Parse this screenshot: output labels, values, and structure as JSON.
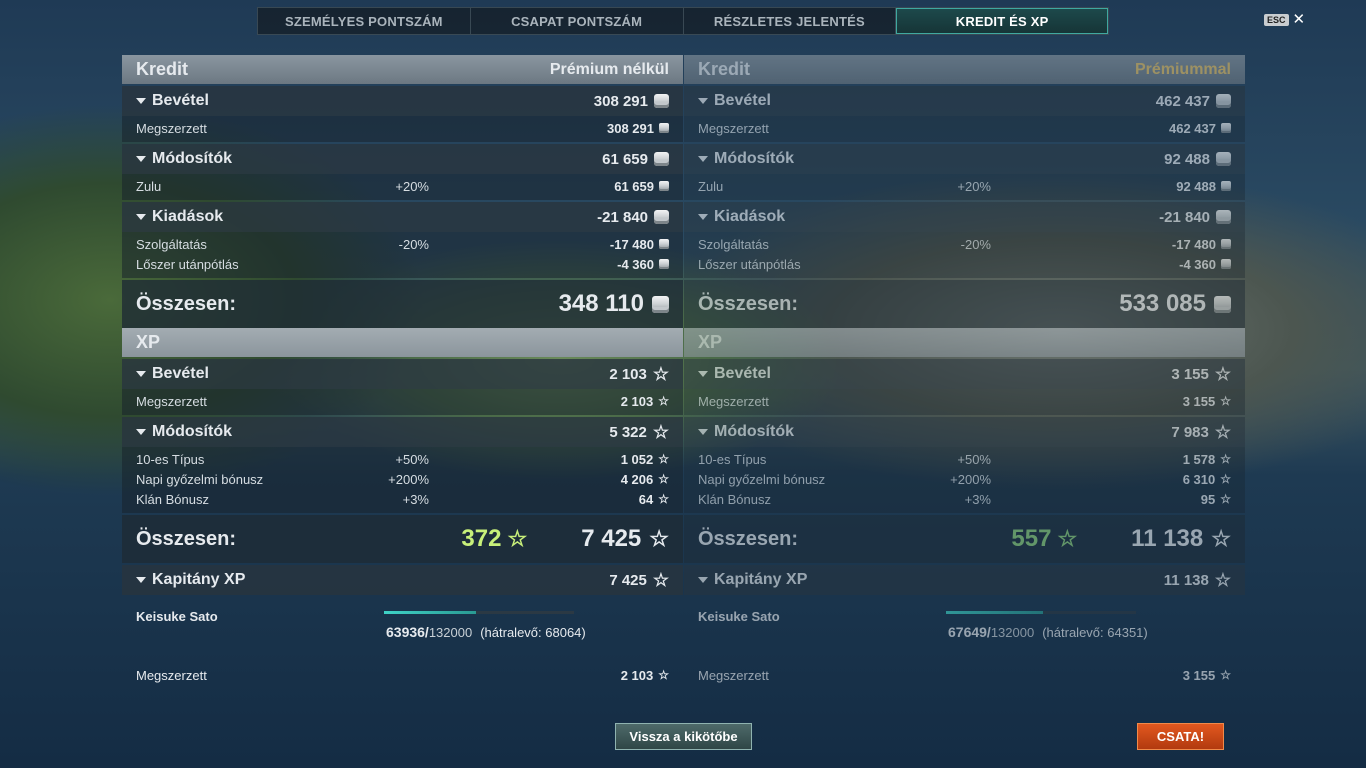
{
  "tabs": [
    "SZEMÉLYES PONTSZÁM",
    "CSAPAT PONTSZÁM",
    "RÉSZLETES JELENTÉS",
    "KREDIT ÉS XP"
  ],
  "esc": "ESC",
  "left": {
    "kredit_title": "Kredit",
    "kredit_sub": "Prémium nélkül",
    "bevetel": {
      "label": "Bevétel",
      "value": "308 291",
      "rows": [
        {
          "l": "Megszerzett",
          "m": "",
          "r": "308 291"
        }
      ]
    },
    "modositok": {
      "label": "Módosítók",
      "value": "61 659",
      "rows": [
        {
          "l": "Zulu",
          "m": "+20%",
          "r": "61 659"
        }
      ]
    },
    "kiadasok": {
      "label": "Kiadások",
      "value": "-21 840",
      "rows": [
        {
          "l": "Szolgáltatás",
          "m": "-20%",
          "r": "-17 480"
        },
        {
          "l": "Lőszer utánpótlás",
          "m": "",
          "r": "-4 360"
        }
      ]
    },
    "kredit_total": {
      "label": "Összesen:",
      "value": "348 110"
    },
    "xp_title": "XP",
    "xp_bevetel": {
      "label": "Bevétel",
      "value": "2 103",
      "rows": [
        {
          "l": "Megszerzett",
          "m": "",
          "r": "2 103"
        }
      ]
    },
    "xp_modositok": {
      "label": "Módosítók",
      "value": "5 322",
      "rows": [
        {
          "l": "10-es Típus",
          "m": "+50%",
          "r": "1 052"
        },
        {
          "l": "Napi győzelmi bónusz",
          "m": "+200%",
          "r": "4 206"
        },
        {
          "l": "Klán Bónusz",
          "m": "+3%",
          "r": "64"
        }
      ]
    },
    "xp_total": {
      "label": "Összesen:",
      "free": "372",
      "value": "7 425"
    },
    "kapitany": {
      "label": "Kapitány XP",
      "value": "7 425",
      "name": "Keisuke Sato",
      "current": "63936/",
      "max": "132000",
      "remaining": "(hátralevő: 68064)",
      "progress": 0.484,
      "earned_label": "Megszerzett",
      "earned": "2 103"
    }
  },
  "right": {
    "kredit_title": "Kredit",
    "kredit_sub": "Prémiummal",
    "bevetel": {
      "label": "Bevétel",
      "value": "462 437",
      "rows": [
        {
          "l": "Megszerzett",
          "m": "",
          "r": "462 437"
        }
      ]
    },
    "modositok": {
      "label": "Módosítók",
      "value": "92 488",
      "rows": [
        {
          "l": "Zulu",
          "m": "+20%",
          "r": "92 488"
        }
      ]
    },
    "kiadasok": {
      "label": "Kiadások",
      "value": "-21 840",
      "rows": [
        {
          "l": "Szolgáltatás",
          "m": "-20%",
          "r": "-17 480"
        },
        {
          "l": "Lőszer utánpótlás",
          "m": "",
          "r": "-4 360"
        }
      ]
    },
    "kredit_total": {
      "label": "Összesen:",
      "value": "533 085"
    },
    "xp_title": "XP",
    "xp_bevetel": {
      "label": "Bevétel",
      "value": "3 155",
      "rows": [
        {
          "l": "Megszerzett",
          "m": "",
          "r": "3 155"
        }
      ]
    },
    "xp_modositok": {
      "label": "Módosítók",
      "value": "7 983",
      "rows": [
        {
          "l": "10-es Típus",
          "m": "+50%",
          "r": "1 578"
        },
        {
          "l": "Napi győzelmi bónusz",
          "m": "+200%",
          "r": "6 310"
        },
        {
          "l": "Klán Bónusz",
          "m": "+3%",
          "r": "95"
        }
      ]
    },
    "xp_total": {
      "label": "Összesen:",
      "free": "557",
      "value": "11 138"
    },
    "kapitany": {
      "label": "Kapitány XP",
      "value": "11 138",
      "name": "Keisuke Sato",
      "current": "67649/",
      "max": "132000",
      "remaining": "(hátralevő: 64351)",
      "progress": 0.512,
      "earned_label": "Megszerzett",
      "earned": "3 155"
    }
  },
  "buttons": {
    "back": "Vissza a kikötőbe",
    "battle": "CSATA!"
  },
  "colors": {
    "accent": "#3fa8a0",
    "battle": "#d04a17",
    "premium": "#e9c46a",
    "free_xp": "#c8f07a"
  }
}
